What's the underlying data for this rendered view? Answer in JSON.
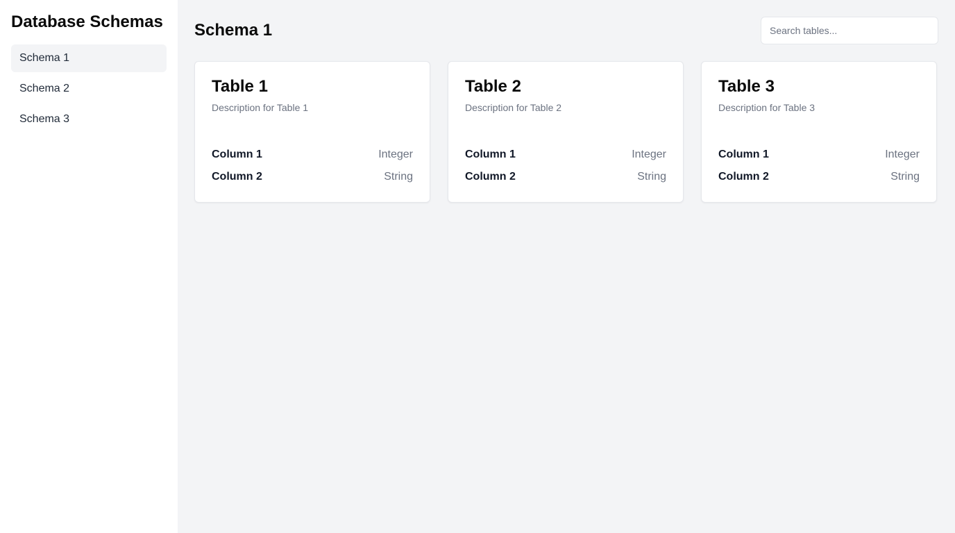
{
  "sidebar": {
    "title": "Database Schemas",
    "items": [
      {
        "label": "Schema 1",
        "active": true
      },
      {
        "label": "Schema 2",
        "active": false
      },
      {
        "label": "Schema 3",
        "active": false
      }
    ]
  },
  "header": {
    "title": "Schema 1",
    "search_placeholder": "Search tables..."
  },
  "tables": [
    {
      "title": "Table 1",
      "description": "Description for Table 1",
      "columns": [
        {
          "name": "Column 1",
          "type": "Integer"
        },
        {
          "name": "Column 2",
          "type": "String"
        }
      ]
    },
    {
      "title": "Table 2",
      "description": "Description for Table 2",
      "columns": [
        {
          "name": "Column 1",
          "type": "Integer"
        },
        {
          "name": "Column 2",
          "type": "String"
        }
      ]
    },
    {
      "title": "Table 3",
      "description": "Description for Table 3",
      "columns": [
        {
          "name": "Column 1",
          "type": "Integer"
        },
        {
          "name": "Column 2",
          "type": "String"
        }
      ]
    }
  ],
  "colors": {
    "sidebar_bg": "#ffffff",
    "main_bg": "#f3f4f6",
    "active_item_bg": "#f3f4f6",
    "muted_text": "#6b7280"
  }
}
